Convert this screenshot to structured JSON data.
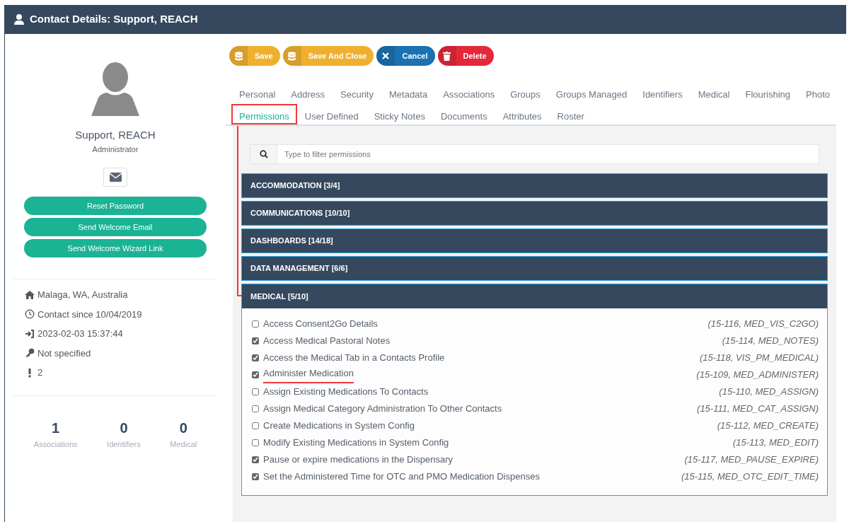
{
  "window": {
    "title": "Contact Details: Support, REACH"
  },
  "profile": {
    "name": "Support, REACH",
    "role": "Administrator"
  },
  "profile_buttons": [
    "Reset Password",
    "Send Welcome Email",
    "Send Welcome Wizard Link"
  ],
  "details": [
    {
      "kind": "home",
      "text": "Malaga, WA, Australia"
    },
    {
      "kind": "clock",
      "text": "Contact since 10/04/2019"
    },
    {
      "kind": "login",
      "text": "2023-02-03 15:37:44"
    },
    {
      "kind": "key",
      "text": "Not specified"
    },
    {
      "kind": "alert",
      "text": "2"
    }
  ],
  "stats": [
    {
      "value": "1",
      "label": "Associations"
    },
    {
      "value": "0",
      "label": "Identifiers"
    },
    {
      "value": "0",
      "label": "Medical"
    }
  ],
  "actions": [
    {
      "kind": "save",
      "label": "Save"
    },
    {
      "kind": "save",
      "label": "Save And Close"
    },
    {
      "kind": "cancel",
      "label": "Cancel"
    },
    {
      "kind": "delete",
      "label": "Delete"
    }
  ],
  "tabs": [
    [
      {
        "label": "Personal",
        "selected": false,
        "highlighted": false
      },
      {
        "label": "Address",
        "selected": false,
        "highlighted": false
      },
      {
        "label": "Security",
        "selected": false,
        "highlighted": false
      },
      {
        "label": "Metadata",
        "selected": false,
        "highlighted": false
      },
      {
        "label": "Associations",
        "selected": false,
        "highlighted": false
      },
      {
        "label": "Groups",
        "selected": false,
        "highlighted": false
      },
      {
        "label": "Groups Managed",
        "selected": false,
        "highlighted": false
      },
      {
        "label": "Identifiers",
        "selected": false,
        "highlighted": false
      },
      {
        "label": "Medical",
        "selected": false,
        "highlighted": false
      },
      {
        "label": "Flourishing",
        "selected": false,
        "highlighted": false
      },
      {
        "label": "Photo",
        "selected": false,
        "highlighted": false
      }
    ],
    [
      {
        "label": "Permissions",
        "selected": true,
        "highlighted": true
      },
      {
        "label": "User Defined",
        "selected": false,
        "highlighted": false
      },
      {
        "label": "Sticky Notes",
        "selected": false,
        "highlighted": false
      },
      {
        "label": "Documents",
        "selected": false,
        "highlighted": false
      },
      {
        "label": "Attributes",
        "selected": false,
        "highlighted": false
      },
      {
        "label": "Roster",
        "selected": false,
        "highlighted": false
      }
    ]
  ],
  "filter": {
    "placeholder": "Type to filter permissions"
  },
  "groups": [
    {
      "title": "ACCOMMODATION [3/4]",
      "expanded": false
    },
    {
      "title": "COMMUNICATIONS [10/10]",
      "expanded": false
    },
    {
      "title": "DASHBOARDS [14/18]",
      "expanded": false
    },
    {
      "title": "DATA MANAGEMENT [6/6]",
      "expanded": false
    },
    {
      "title": "MEDICAL [5/10]",
      "expanded": true,
      "items": [
        {
          "label": "Access Consent2Go Details",
          "code": "(15-116, MED_VIS_C2GO)",
          "checked": false,
          "underlined": false
        },
        {
          "label": "Access Medical Pastoral Notes",
          "code": "(15-114, MED_NOTES)",
          "checked": true,
          "underlined": false
        },
        {
          "label": "Access the Medical Tab in a Contacts Profile",
          "code": "(15-118, VIS_PM_MEDICAL)",
          "checked": true,
          "underlined": false
        },
        {
          "label": "Administer Medication",
          "code": "(15-109, MED_ADMINISTER)",
          "checked": true,
          "underlined": true
        },
        {
          "label": "Assign Existing Medications To Contacts",
          "code": "(15-110, MED_ASSIGN)",
          "checked": false,
          "underlined": false
        },
        {
          "label": "Assign Medical Category Administration To Other Contacts",
          "code": "(15-111, MED_CAT_ASSIGN)",
          "checked": false,
          "underlined": false
        },
        {
          "label": "Create Medications in System Config",
          "code": "(15-112, MED_CREATE)",
          "checked": false,
          "underlined": false
        },
        {
          "label": "Modify Existing Medications in System Config",
          "code": "(15-113, MED_EDIT)",
          "checked": false,
          "underlined": false
        },
        {
          "label": "Pause or expire medications in the Dispensary",
          "code": "(15-117, MED_PAUSE_EXPIRE)",
          "checked": true,
          "underlined": false
        },
        {
          "label": "Set the Administered Time for OTC and PMO Medication Dispenses",
          "code": "(15-115, MED_OTC_EDIT_TIME)",
          "checked": true,
          "underlined": false
        }
      ]
    }
  ]
}
